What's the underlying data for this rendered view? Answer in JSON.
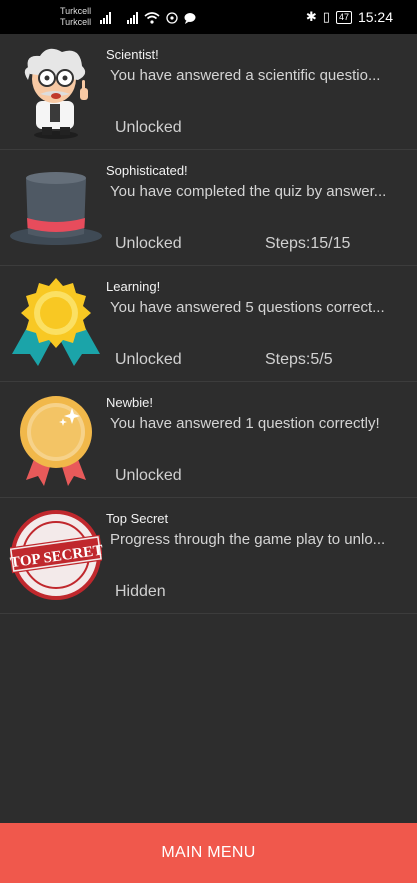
{
  "status_bar": {
    "carrier_1": "Turkcell",
    "carrier_2": "Turkcell",
    "battery": "47",
    "time": "15:24"
  },
  "achievements": [
    {
      "title": "Scientist!",
      "description": "You have answered a scientific questio...",
      "state": "Unlocked",
      "steps": "",
      "icon": "scientist-icon"
    },
    {
      "title": "Sophisticated!",
      "description": "You have completed the quiz by answer...",
      "state": "Unlocked",
      "steps": "Steps:15/15",
      "icon": "top-hat-icon"
    },
    {
      "title": "Learning!",
      "description": "You have answered 5 questions correct...",
      "state": "Unlocked",
      "steps": "Steps:5/5",
      "icon": "award-rosette-icon"
    },
    {
      "title": "Newbie!",
      "description": "You have answered 1 question correctly!",
      "state": "Unlocked",
      "steps": "",
      "icon": "medal-icon"
    },
    {
      "title": "Top Secret",
      "description": "Progress through the game play to unlo...",
      "state": "Hidden",
      "steps": "",
      "icon": "top-secret-stamp-icon"
    }
  ],
  "stamp_text": "TOP SECRET",
  "main_menu_label": "MAIN MENU",
  "colors": {
    "background": "#2d2d2d",
    "button": "#f0584c",
    "status_bar": "#000000"
  }
}
